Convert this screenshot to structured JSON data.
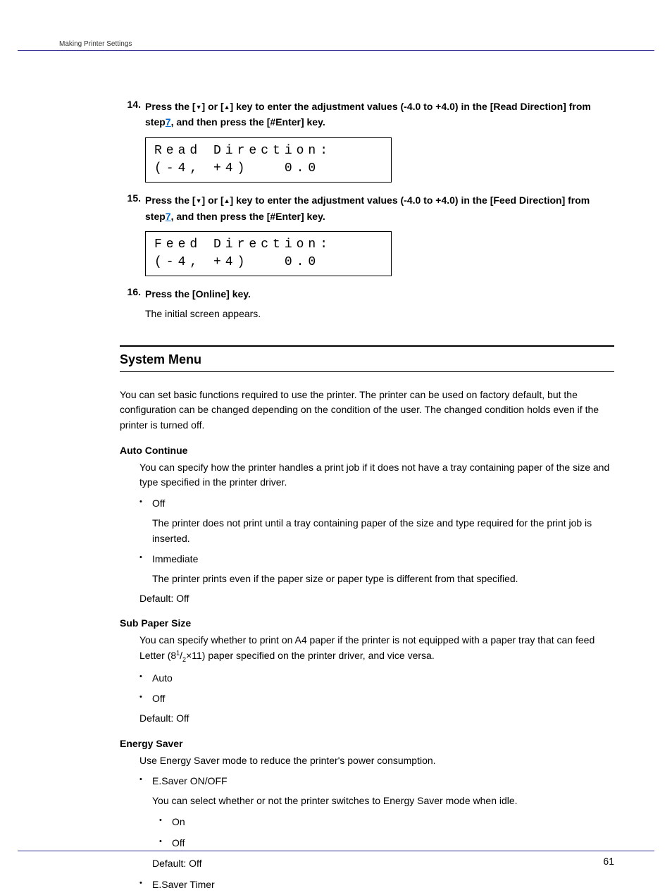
{
  "header": "Making Printer Settings",
  "steps": [
    {
      "num": "14.",
      "pre": "Press the [",
      "tri1": "▼",
      "mid1": "] or [",
      "tri2": "▲",
      "post1": "] key to enter the adjustment values (-4.0 to +4.0) in the [Read Direction] from step",
      "linkNum": "7",
      "post2": ", and then press the [#Enter] key.",
      "lcd1": "Read Direction:",
      "lcd2": "(-4, +4)   0.0"
    },
    {
      "num": "15.",
      "pre": "Press the [",
      "tri1": "▼",
      "mid1": "] or [",
      "tri2": "▲",
      "post1": "] key to enter the adjustment values (-4.0 to +4.0) in the [Feed Direction] from step",
      "linkNum": "7",
      "post2": ", and then press the [#Enter] key.",
      "lcd1": "Feed Direction:",
      "lcd2": "(-4, +4)   0.0"
    },
    {
      "num": "16.",
      "text": "Press the [Online] key.",
      "sub": "The initial screen appears."
    }
  ],
  "section": {
    "title": "System Menu",
    "intro": "You can set basic functions required to use the printer. The printer can be used on factory default, but the configuration can be changed depending on the condition of the user. The changed condition holds even if the printer is turned off.",
    "items": [
      {
        "term": "Auto Continue",
        "desc": "You can specify how the printer handles a print job if it does not have a tray containing paper of the size and type specified in the printer driver.",
        "bullets": [
          {
            "label": "Off",
            "desc": "The printer does not print until a tray containing paper of the size and type required for the print job is inserted."
          },
          {
            "label": "Immediate",
            "desc": "The printer prints even if the paper size or paper type is different from that specified."
          }
        ],
        "default": "Default: Off"
      },
      {
        "term": "Sub Paper Size",
        "desc_html": true,
        "desc_pre": "You can specify whether to print on A4 paper if the printer is not equipped with a paper tray that can feed Letter (8",
        "desc_sup": "1",
        "desc_slash": "/",
        "desc_sub": "2",
        "desc_post": "×11) paper specified on the printer driver, and vice versa.",
        "bullets": [
          {
            "label": "Auto"
          },
          {
            "label": "Off"
          }
        ],
        "default": "Default: Off"
      },
      {
        "term": "Energy Saver",
        "desc": "Use Energy Saver mode to reduce the printer's power consumption.",
        "bullets": [
          {
            "label": "E.Saver ON/OFF",
            "desc": "You can select whether or not the printer switches to Energy Saver mode when idle.",
            "nested": [
              {
                "label": "On"
              },
              {
                "label": "Off"
              }
            ],
            "nested_default": "Default: Off"
          },
          {
            "label": "E.Saver Timer"
          }
        ]
      }
    ]
  },
  "pageNumber": "61"
}
